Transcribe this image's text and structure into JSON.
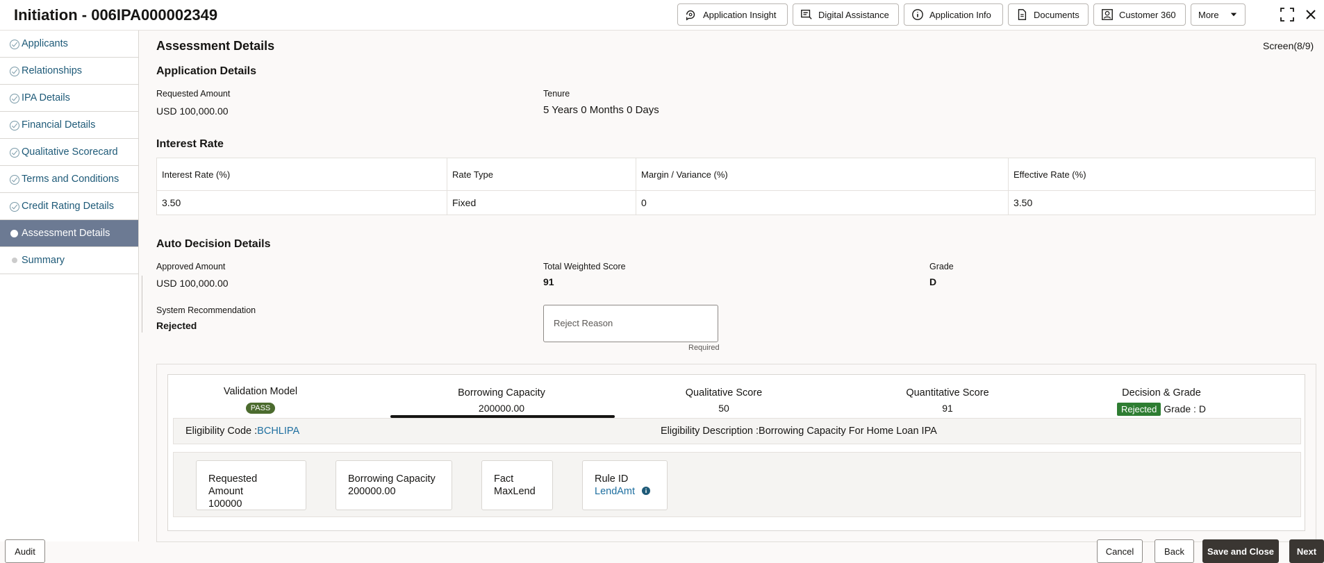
{
  "header": {
    "title": "Initiation - 006IPA000002349",
    "buttons": {
      "app_insight": "Application Insight",
      "digital_assistance": "Digital Assistance",
      "app_info": "Application Info",
      "documents": "Documents",
      "customer_360": "Customer 360",
      "more": "More"
    }
  },
  "sidebar": {
    "items": [
      {
        "label": "Applicants"
      },
      {
        "label": "Relationships"
      },
      {
        "label": "IPA Details"
      },
      {
        "label": "Financial Details"
      },
      {
        "label": "Qualitative Scorecard"
      },
      {
        "label": "Terms and Conditions"
      },
      {
        "label": "Credit Rating Details"
      },
      {
        "label": "Assessment Details"
      },
      {
        "label": "Summary"
      }
    ]
  },
  "main": {
    "title": "Assessment Details",
    "screen": "Screen(8/9)",
    "application": {
      "heading": "Application Details",
      "req_amount_label": "Requested Amount",
      "req_amount_value": "USD 100,000.00",
      "tenure_label": "Tenure",
      "tenure_value": "5 Years 0 Months 0 Days"
    },
    "interest": {
      "heading": "Interest Rate",
      "headers": [
        "Interest Rate (%)",
        "Rate Type",
        "Margin / Variance (%)",
        "Effective Rate (%)"
      ],
      "row": [
        "3.50",
        "Fixed",
        "0",
        "3.50"
      ]
    },
    "auto": {
      "heading": "Auto Decision Details",
      "approved_label": "Approved Amount",
      "approved_value": "USD 100,000.00",
      "score_label": "Total Weighted Score",
      "score_value": "91",
      "grade_label": "Grade",
      "grade_value": "D",
      "sysrec_label": "System Recommendation",
      "sysrec_value": "Rejected",
      "reject_placeholder": "Reject Reason",
      "required": "Required"
    },
    "scores": {
      "validation_label": "Validation Model",
      "validation_value": "PASS",
      "borrowing_label": "Borrowing Capacity",
      "borrowing_value": "200000.00",
      "qual_label": "Qualitative Score",
      "qual_value": "50",
      "quant_label": "Quantitative Score",
      "quant_value": "91",
      "decision_label": "Decision & Grade",
      "decision_value": "Rejected",
      "grade_text": "Grade : D"
    },
    "eligibility": {
      "code_label": "Eligibility Code :",
      "code_value": "BCHLIPA",
      "desc": "Eligibility Description :Borrowing Capacity For Home Loan IPA"
    },
    "rules": {
      "req_label": "Requested Amount",
      "req_value": "100000",
      "bc_label": "Borrowing Capacity",
      "bc_value": "200000.00",
      "fact_label": "Fact",
      "fact_value": "MaxLend",
      "rule_label": "Rule ID",
      "rule_value": "LendAmt"
    }
  },
  "footer": {
    "audit": "Audit",
    "cancel": "Cancel",
    "back": "Back",
    "save_close": "Save and Close",
    "next": "Next"
  }
}
